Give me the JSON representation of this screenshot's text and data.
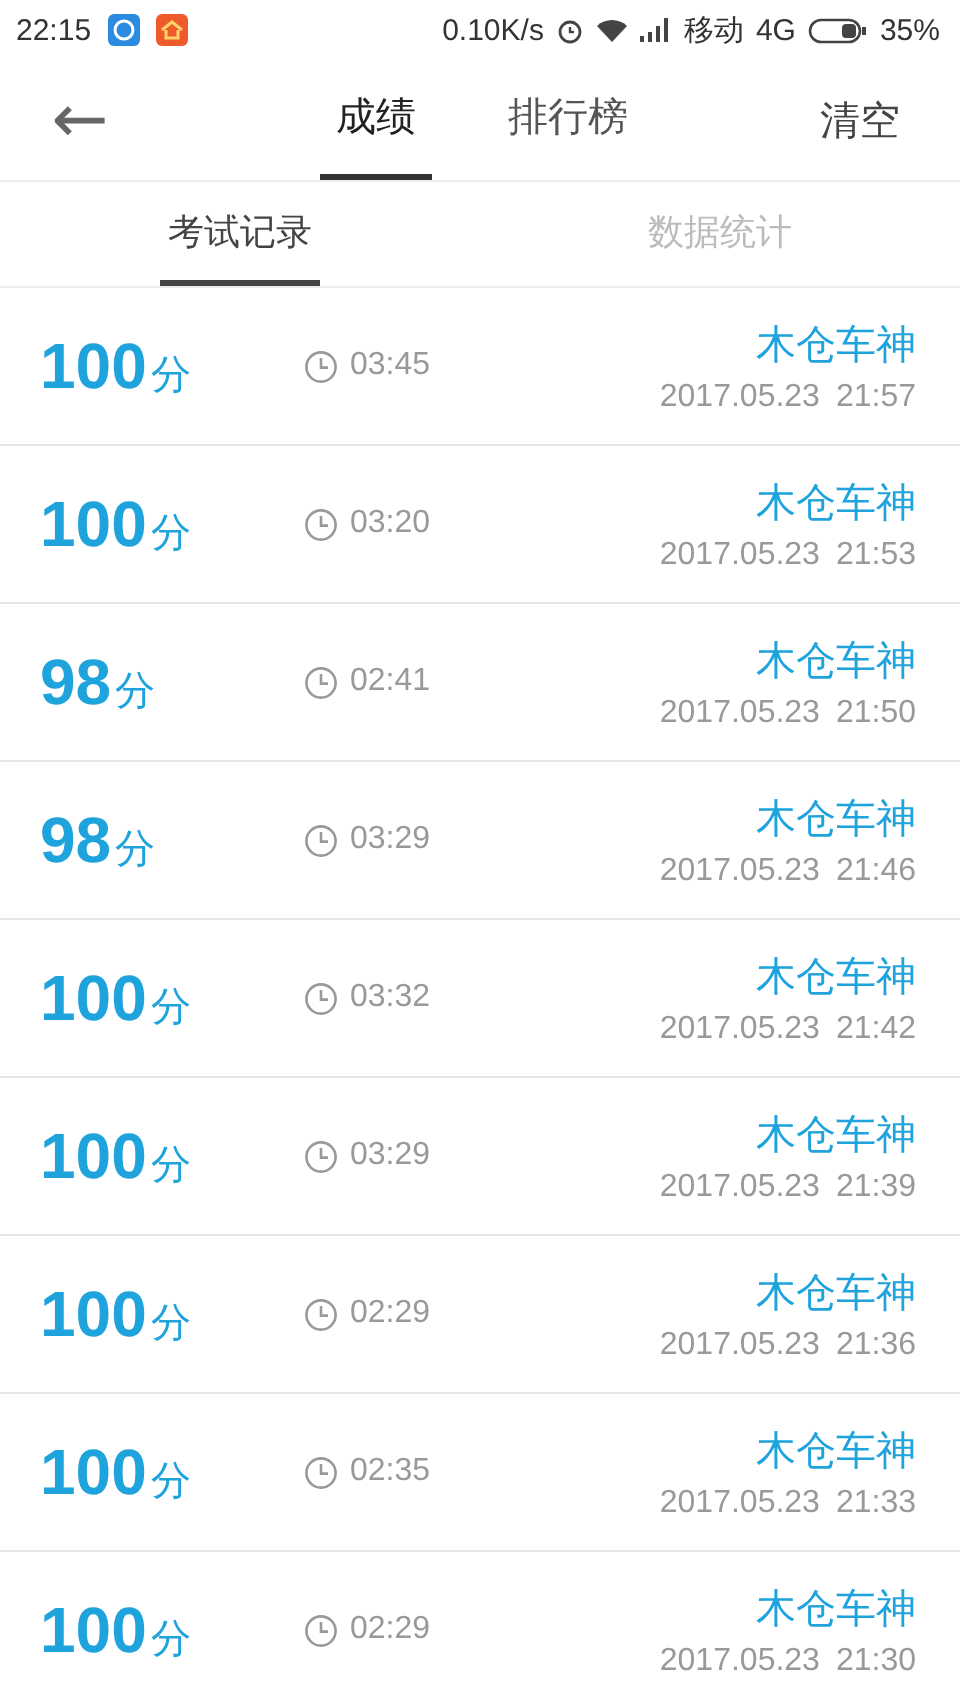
{
  "status_bar": {
    "time": "22:15",
    "speed": "0.10K/s",
    "carrier": "移动",
    "network": "4G",
    "battery": "35%"
  },
  "header": {
    "back": "←",
    "tabs": [
      {
        "label": "成绩",
        "selected": true
      },
      {
        "label": "排行榜",
        "selected": false
      }
    ],
    "action": "清空"
  },
  "sub_tabs": [
    {
      "label": "考试记录",
      "selected": true
    },
    {
      "label": "数据统计",
      "selected": false
    }
  ],
  "records": [
    {
      "score": "100",
      "unit": "分",
      "duration": "03:45",
      "name": "木仓车神",
      "date": "2017.05.23",
      "time": "21:57"
    },
    {
      "score": "100",
      "unit": "分",
      "duration": "03:20",
      "name": "木仓车神",
      "date": "2017.05.23",
      "time": "21:53"
    },
    {
      "score": "98",
      "unit": "分",
      "duration": "02:41",
      "name": "木仓车神",
      "date": "2017.05.23",
      "time": "21:50"
    },
    {
      "score": "98",
      "unit": "分",
      "duration": "03:29",
      "name": "木仓车神",
      "date": "2017.05.23",
      "time": "21:46"
    },
    {
      "score": "100",
      "unit": "分",
      "duration": "03:32",
      "name": "木仓车神",
      "date": "2017.05.23",
      "time": "21:42"
    },
    {
      "score": "100",
      "unit": "分",
      "duration": "03:29",
      "name": "木仓车神",
      "date": "2017.05.23",
      "time": "21:39"
    },
    {
      "score": "100",
      "unit": "分",
      "duration": "02:29",
      "name": "木仓车神",
      "date": "2017.05.23",
      "time": "21:36"
    },
    {
      "score": "100",
      "unit": "分",
      "duration": "02:35",
      "name": "木仓车神",
      "date": "2017.05.23",
      "time": "21:33"
    },
    {
      "score": "100",
      "unit": "分",
      "duration": "02:29",
      "name": "木仓车神",
      "date": "2017.05.23",
      "time": "21:30"
    }
  ]
}
